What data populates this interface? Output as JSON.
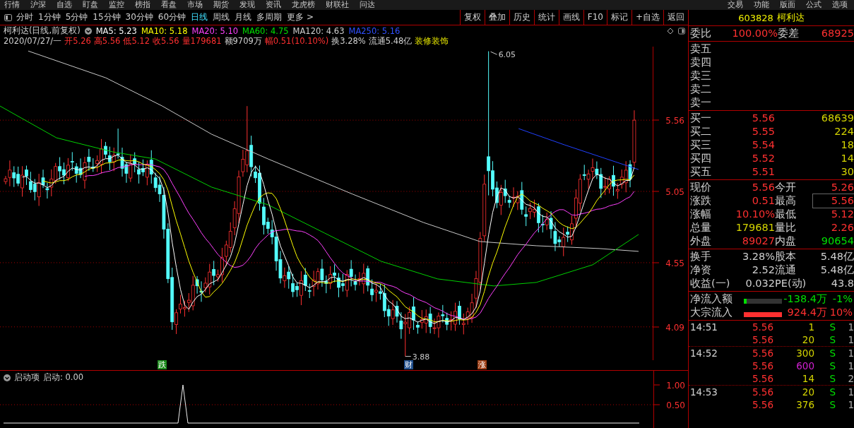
{
  "top_menu": {
    "left": [
      "行情",
      "沪深",
      "自选",
      "盯盘",
      "监控",
      "榜指",
      "看盘",
      "市场",
      "期货",
      "发现",
      "资讯",
      "龙虎榜",
      "财联社",
      "问达"
    ],
    "right": [
      "交易",
      "功能",
      "版面",
      "公式",
      "选项"
    ]
  },
  "toolbar": {
    "periods": [
      {
        "label": "分时",
        "selected": false
      },
      {
        "label": "1分钟",
        "selected": false
      },
      {
        "label": "5分钟",
        "selected": false
      },
      {
        "label": "15分钟",
        "selected": false
      },
      {
        "label": "30分钟",
        "selected": false
      },
      {
        "label": "60分钟",
        "selected": false
      },
      {
        "label": "日线",
        "selected": true
      },
      {
        "label": "周线",
        "selected": false
      },
      {
        "label": "月线",
        "selected": false
      },
      {
        "label": "多周期",
        "selected": false
      },
      {
        "label": "更多 >",
        "selected": false
      }
    ],
    "buttons": [
      "复权",
      "叠加",
      "历史",
      "统计",
      "画线",
      "F10",
      "标记",
      "+自选",
      "返回"
    ]
  },
  "chart": {
    "title": "柯利达(日线,前复权)",
    "indicators": [
      {
        "label": "MA5: 5.23",
        "color": "#ffffff"
      },
      {
        "label": "MA10: 5.18",
        "color": "#ffff00"
      },
      {
        "label": "MA20: 5.10",
        "color": "#ff40ff"
      },
      {
        "label": "MA60: 4.75",
        "color": "#00e000"
      },
      {
        "label": "MA120: 4.63",
        "color": "#d0d0d0"
      },
      {
        "label": "MA250: 5.16",
        "color": "#3050ff"
      }
    ],
    "info": [
      {
        "text": "2020/07/27/一",
        "color": "#d0d0d0"
      },
      {
        "text": "开5.26",
        "color": "#ff3030"
      },
      {
        "text": "高5.56",
        "color": "#ff3030"
      },
      {
        "text": "低5.12",
        "color": "#ff3030"
      },
      {
        "text": "收5.56",
        "color": "#ff3030"
      },
      {
        "text": "量179681",
        "color": "#ff3030"
      },
      {
        "text": "额9709万",
        "color": "#d0d0d0"
      },
      {
        "text": "幅0.51(10.10%)",
        "color": "#ff3030"
      },
      {
        "text": "换3.28%",
        "color": "#d0d0d0"
      },
      {
        "text": "流通5.48亿",
        "color": "#d0d0d0"
      },
      {
        "text": "装修装饰",
        "color": "#e0e000"
      }
    ],
    "y_axis": [
      "5.56",
      "5.05",
      "4.55",
      "4.09"
    ],
    "peak_label": "6.05",
    "trough_label": "3.88",
    "markers": [
      {
        "label": "跌",
        "color": "#1a8a1a"
      },
      {
        "label": "财",
        "color": "#1f4e8c"
      },
      {
        "label": "涨",
        "color": "#9a3a10"
      }
    ]
  },
  "indicator_panel": {
    "title": "启动项",
    "reading": "启动: 0.00",
    "y_axis": [
      "1.00",
      "0.50"
    ]
  },
  "quote": {
    "code": "603828",
    "name": "柯利达",
    "ratio": {
      "label": "委比",
      "value": "100.00%",
      "label2": "委差",
      "value2": "68925"
    },
    "asks": [
      {
        "label": "卖五"
      },
      {
        "label": "卖四"
      },
      {
        "label": "卖三"
      },
      {
        "label": "卖二"
      },
      {
        "label": "卖一"
      }
    ],
    "bids": [
      {
        "label": "买一",
        "price": "5.56",
        "volume": "68639"
      },
      {
        "label": "买二",
        "price": "5.55",
        "volume": "224"
      },
      {
        "label": "买三",
        "price": "5.54",
        "volume": "18"
      },
      {
        "label": "买四",
        "price": "5.52",
        "volume": "14"
      },
      {
        "label": "买五",
        "price": "5.51",
        "volume": "30"
      }
    ],
    "stat_groups": [
      {
        "items": [
          {
            "label": "现价",
            "value": "5.56",
            "color": "#ff3030",
            "highlighted": false
          },
          {
            "label": "今开",
            "value": "5.26",
            "color": "#ff3030",
            "highlighted": false
          },
          {
            "label": "涨跌",
            "value": "0.51",
            "color": "#ff3030",
            "highlighted": false
          },
          {
            "label": "最高",
            "value": "5.56",
            "color": "#ff3030",
            "highlighted": true
          },
          {
            "label": "涨幅",
            "value": "10.10%",
            "color": "#ff3030",
            "highlighted": false
          },
          {
            "label": "最低",
            "value": "5.12",
            "color": "#ff3030",
            "highlighted": false
          },
          {
            "label": "总量",
            "value": "179681",
            "color": "#d4d400",
            "highlighted": false
          },
          {
            "label": "量比",
            "value": "2.26",
            "color": "#ff3030",
            "highlighted": false
          },
          {
            "label": "外盘",
            "value": "89027",
            "color": "#ff3030",
            "highlighted": false
          },
          {
            "label": "内盘",
            "value": "90654",
            "color": "#00e000",
            "highlighted": false
          }
        ]
      },
      {
        "items": [
          {
            "label": "换手",
            "value": "3.28%",
            "color": "#d0d0d0",
            "highlighted": false
          },
          {
            "label": "股本",
            "value": "5.48亿",
            "color": "#d0d0d0",
            "highlighted": false
          },
          {
            "label": "净资",
            "value": "2.52",
            "color": "#d0d0d0",
            "highlighted": false
          },
          {
            "label": "流通",
            "value": "5.48亿",
            "color": "#d0d0d0",
            "highlighted": false
          },
          {
            "label": "收益(一)",
            "value": "0.032",
            "color": "#d0d0d0",
            "highlighted": false
          },
          {
            "label": "PE(动)",
            "value": "43.8",
            "color": "#d0d0d0",
            "highlighted": false
          }
        ]
      }
    ],
    "fund_flow": [
      {
        "label": "净流入额",
        "level": 0.08,
        "value": "-138.4万",
        "share": "-1%",
        "color": "#00e000"
      },
      {
        "label": "大宗流入",
        "level": 1,
        "value": "924.4万",
        "share": "10%",
        "color": "#ff3030"
      }
    ],
    "ticks": [
      {
        "time": "14:51",
        "price": "5.56",
        "volume": "1",
        "color": "#d4d400",
        "side": "S",
        "count": "1"
      },
      {
        "price": "5.56",
        "volume": "20",
        "color": "#d4d400",
        "side": "S",
        "count": "1"
      },
      {
        "time": "14:52",
        "price": "5.56",
        "volume": "300",
        "color": "#d4d400",
        "side": "S",
        "count": "1"
      },
      {
        "price": "5.56",
        "volume": "600",
        "color": "#d020d0",
        "side": "S",
        "count": "1"
      },
      {
        "price": "5.56",
        "volume": "14",
        "color": "#d4d400",
        "side": "S",
        "count": "2"
      },
      {
        "time": "14:53",
        "price": "5.56",
        "volume": "20",
        "color": "#d4d400",
        "side": "S",
        "count": "1"
      },
      {
        "price": "5.56",
        "volume": "376",
        "color": "#d4d400",
        "side": "S",
        "count": "1"
      }
    ]
  }
}
